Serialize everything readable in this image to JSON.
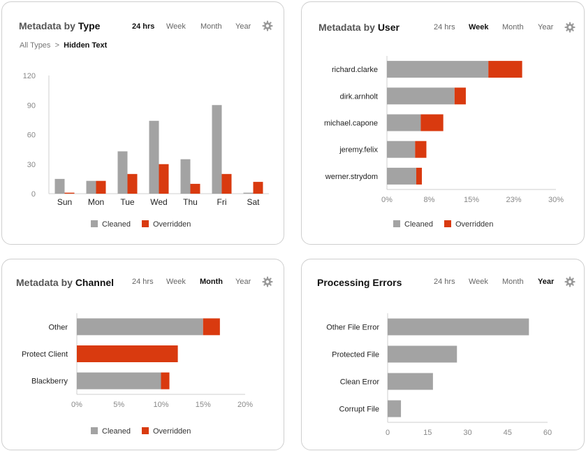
{
  "colors": {
    "cleaned": "#a3a3a3",
    "overridden": "#d93a0f",
    "axis": "#cfcfcf",
    "tick": "#888888"
  },
  "type_card": {
    "title_prefix": "Metadata by ",
    "title_strong": "Type",
    "tabs": [
      {
        "label": "24 hrs",
        "active": true
      },
      {
        "label": "Week",
        "active": false
      },
      {
        "label": "Month",
        "active": false
      },
      {
        "label": "Year",
        "active": false
      }
    ],
    "gear_icon": "gear-icon",
    "breadcrumb": {
      "root": "All Types",
      "separator": ">",
      "current": "Hidden Text"
    }
  },
  "user_card": {
    "title_prefix": "Metadata by ",
    "title_strong": "User",
    "tabs": [
      {
        "label": "24 hrs",
        "active": false
      },
      {
        "label": "Week",
        "active": true
      },
      {
        "label": "Month",
        "active": false
      },
      {
        "label": "Year",
        "active": false
      }
    ],
    "gear_icon": "gear-icon"
  },
  "channel_card": {
    "title_prefix": "Metadata by ",
    "title_strong": "Channel",
    "tabs": [
      {
        "label": "24 hrs",
        "active": false
      },
      {
        "label": "Week",
        "active": false
      },
      {
        "label": "Month",
        "active": true
      },
      {
        "label": "Year",
        "active": false
      }
    ],
    "gear_icon": "gear-icon"
  },
  "errors_card": {
    "title_prefix": "",
    "title_strong": "Processing Errors",
    "tabs": [
      {
        "label": "24 hrs",
        "active": false
      },
      {
        "label": "Week",
        "active": false
      },
      {
        "label": "Month",
        "active": false
      },
      {
        "label": "Year",
        "active": true
      }
    ],
    "gear_icon": "gear-icon"
  },
  "chart_data": [
    {
      "id": "type",
      "type": "bar",
      "orientation": "vertical",
      "categories": [
        "Sun",
        "Mon",
        "Tue",
        "Wed",
        "Thu",
        "Fri",
        "Sat"
      ],
      "series": [
        {
          "name": "Cleaned",
          "values": [
            15,
            13,
            43,
            74,
            35,
            90,
            1
          ]
        },
        {
          "name": "Overridden",
          "values": [
            1,
            13,
            20,
            30,
            10,
            20,
            12
          ]
        }
      ],
      "ylim": [
        0,
        120
      ],
      "yticks": [
        "0",
        "30",
        "60",
        "90",
        "120"
      ],
      "legend": "bottom"
    },
    {
      "id": "user",
      "type": "bar",
      "orientation": "horizontal",
      "stacked": true,
      "categories": [
        "richard.clarke",
        "dirk.arnholt",
        "michael.capone",
        "jeremy.felix",
        "werner.strydom"
      ],
      "series": [
        {
          "name": "Cleaned",
          "values": [
            18,
            12,
            6,
            5,
            5.2
          ]
        },
        {
          "name": "Overridden",
          "values": [
            6,
            2,
            4,
            2,
            1
          ]
        }
      ],
      "xlim": [
        0,
        30
      ],
      "xticks": [
        "0%",
        "8%",
        "15%",
        "23%",
        "30%"
      ],
      "legend": "bottom"
    },
    {
      "id": "channel",
      "type": "bar",
      "orientation": "horizontal",
      "stacked": true,
      "categories": [
        "Other",
        "Protect Client",
        "Blackberry"
      ],
      "series": [
        {
          "name": "Cleaned",
          "values": [
            15,
            0,
            10
          ]
        },
        {
          "name": "Overridden",
          "values": [
            2,
            12,
            1
          ]
        }
      ],
      "xlim": [
        0,
        20
      ],
      "xticks": [
        "0%",
        "5%",
        "10%",
        "15%",
        "20%"
      ],
      "legend": "bottom"
    },
    {
      "id": "errors",
      "type": "bar",
      "orientation": "horizontal",
      "categories": [
        "Other File Error",
        "Protected File",
        "Clean Error",
        "Corrupt File"
      ],
      "series": [
        {
          "values": [
            53,
            26,
            17,
            5
          ]
        }
      ],
      "xlim": [
        0,
        60
      ],
      "xticks": [
        "0",
        "15",
        "30",
        "45",
        "60"
      ]
    }
  ]
}
